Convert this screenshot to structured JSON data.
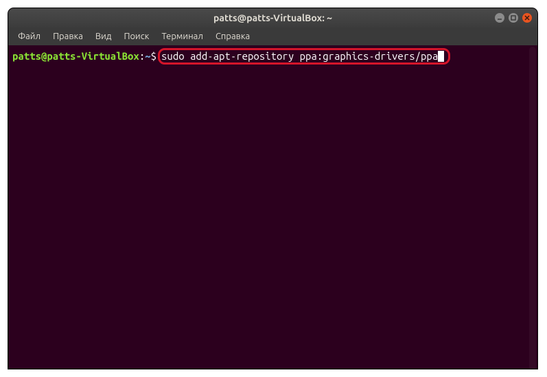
{
  "window": {
    "title": "patts@patts-VirtualBox: ~"
  },
  "menubar": {
    "items": [
      {
        "label": "Файл"
      },
      {
        "label": "Правка"
      },
      {
        "label": "Вид"
      },
      {
        "label": "Поиск"
      },
      {
        "label": "Терминал"
      },
      {
        "label": "Справка"
      }
    ]
  },
  "terminal": {
    "prompt_user_host": "patts@patts-VirtualBox",
    "prompt_colon": ":",
    "prompt_path": "~",
    "prompt_dollar": "$",
    "command": "sudo add-apt-repository ppa:graphics-drivers/ppa"
  },
  "colors": {
    "titlebar_bg": "#3c3c3c",
    "terminal_bg": "#2c001e",
    "prompt_user": "#8ae234",
    "prompt_path": "#729fcf",
    "highlight_border": "#d4152a",
    "close_btn": "#e95420"
  }
}
